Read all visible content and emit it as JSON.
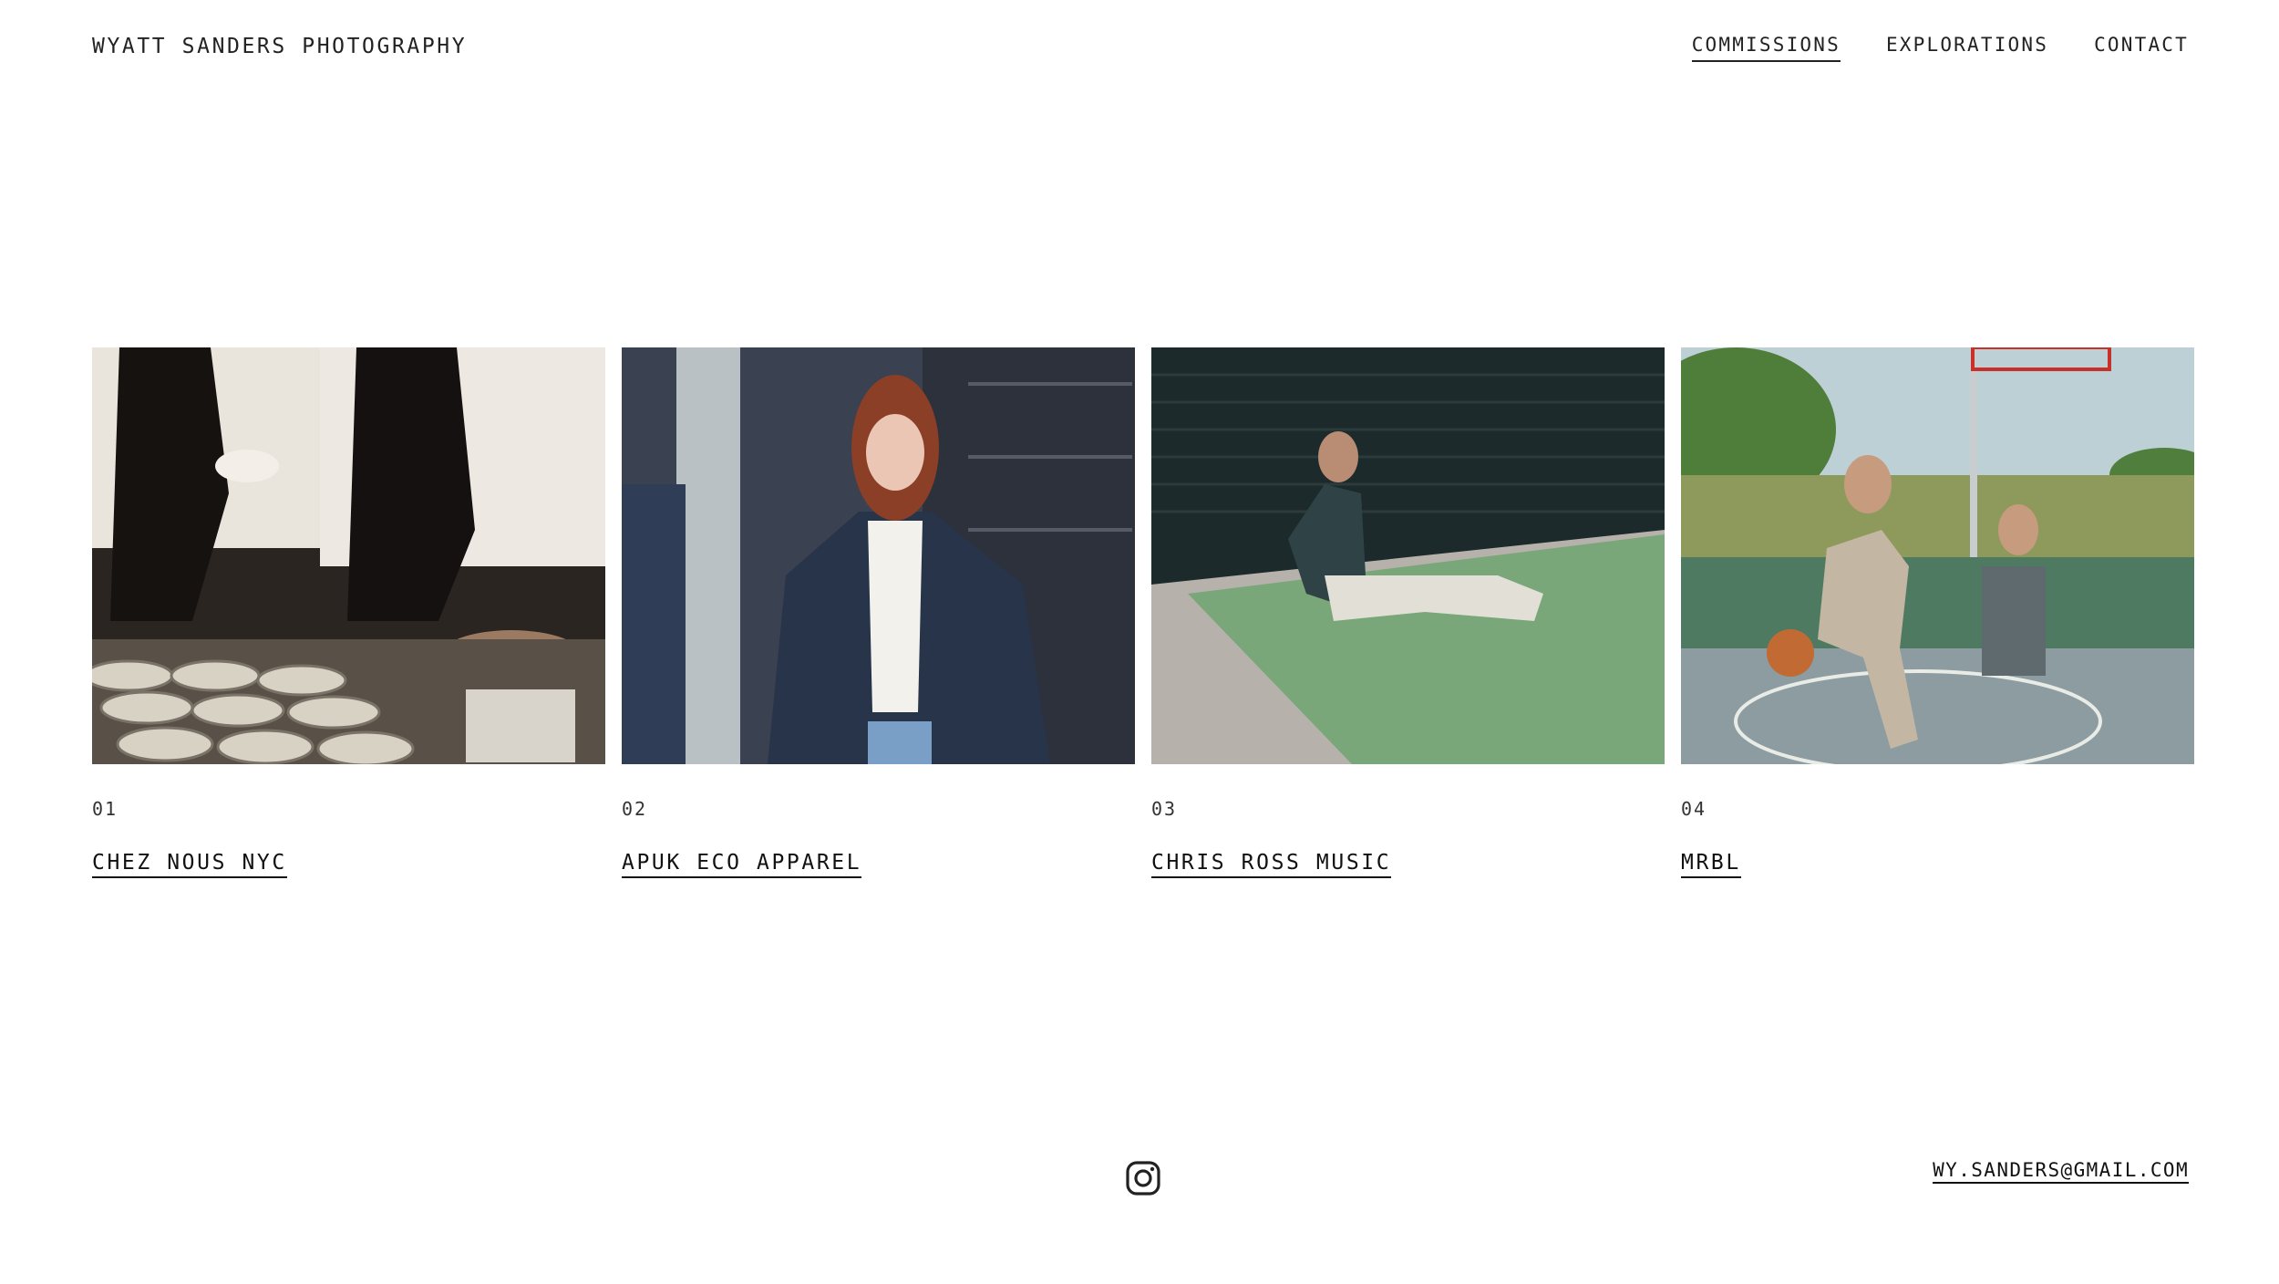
{
  "header": {
    "site_title": "WYATT SANDERS PHOTOGRAPHY",
    "nav": [
      {
        "label": "COMMISSIONS",
        "active": true
      },
      {
        "label": "EXPLORATIONS",
        "active": false
      },
      {
        "label": "CONTACT",
        "active": false
      }
    ]
  },
  "projects": [
    {
      "number": "01",
      "title": "CHEZ NOUS NYC",
      "image": "chefs-plating-food-photo"
    },
    {
      "number": "02",
      "title": "APUK ECO APPAREL",
      "image": "woman-denim-jacket-street-photo"
    },
    {
      "number": "03",
      "title": "CHRIS ROSS MUSIC",
      "image": "man-sitting-on-turf-photo"
    },
    {
      "number": "04",
      "title": "MRBL",
      "image": "basketball-players-court-photo"
    }
  ],
  "footer": {
    "social_icon": "instagram-icon",
    "email": "WY.SANDERS@GMAIL.COM"
  },
  "colors": {
    "text": "#1a1a1a",
    "background": "#ffffff"
  }
}
